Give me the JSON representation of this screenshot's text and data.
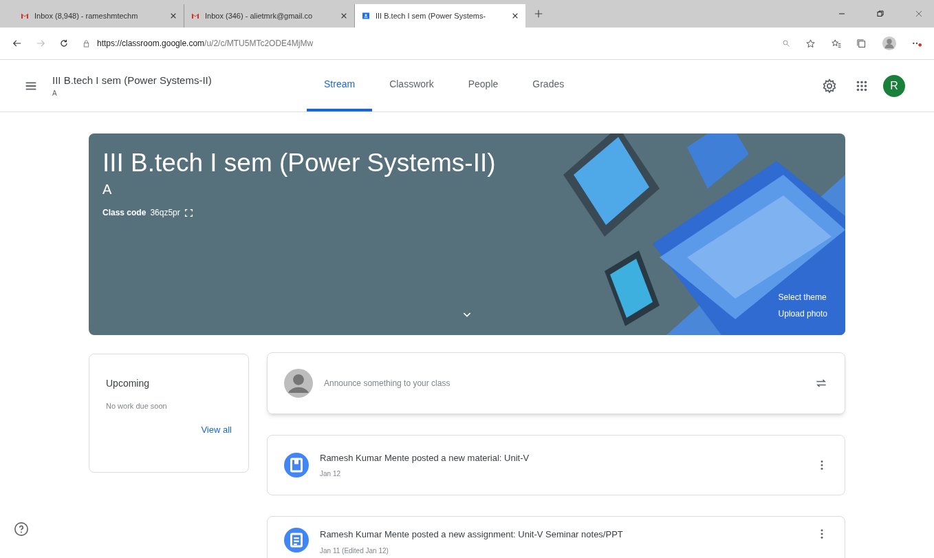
{
  "browser_tabs": [
    {
      "title": "Inbox (8,948) - rameshmtechm",
      "kind": "gmail",
      "selected": false
    },
    {
      "title": "Inbox (346) - alietmrk@gmail.co",
      "kind": "gmail",
      "selected": false
    },
    {
      "title": "III B.tech I sem (Power Systems-",
      "kind": "classroom",
      "selected": true
    }
  ],
  "address_bar": {
    "host": "https://classroom.google.com",
    "path": "/u/2/c/MTU5MTc2ODE4MjMw"
  },
  "header": {
    "class_name": "III B.tech I sem (Power Systems-II)",
    "section": "A",
    "account_initial": "R",
    "tabs": [
      {
        "label": "Stream",
        "selected": true
      },
      {
        "label": "Classwork",
        "selected": false
      },
      {
        "label": "People",
        "selected": false
      },
      {
        "label": "Grades",
        "selected": false
      }
    ]
  },
  "banner": {
    "title": "III B.tech I sem (Power Systems-II)",
    "section": "A",
    "class_code_label": "Class code",
    "class_code": "36qz5pr",
    "links": [
      "Select theme",
      "Upload photo"
    ]
  },
  "upcoming": {
    "title": "Upcoming",
    "message": "No work due soon",
    "link": "View all"
  },
  "announce": {
    "placeholder": "Announce something to your class"
  },
  "posts": [
    {
      "kind": "material",
      "text": "Ramesh Kumar Mente posted a new material: Unit-V",
      "date": "Jan 12"
    },
    {
      "kind": "assignment",
      "text": "Ramesh Kumar Mente posted a new assignment: Unit-V Seminar notes/PPT",
      "date": "Jan 11 (Edited Jan 12)"
    }
  ]
}
